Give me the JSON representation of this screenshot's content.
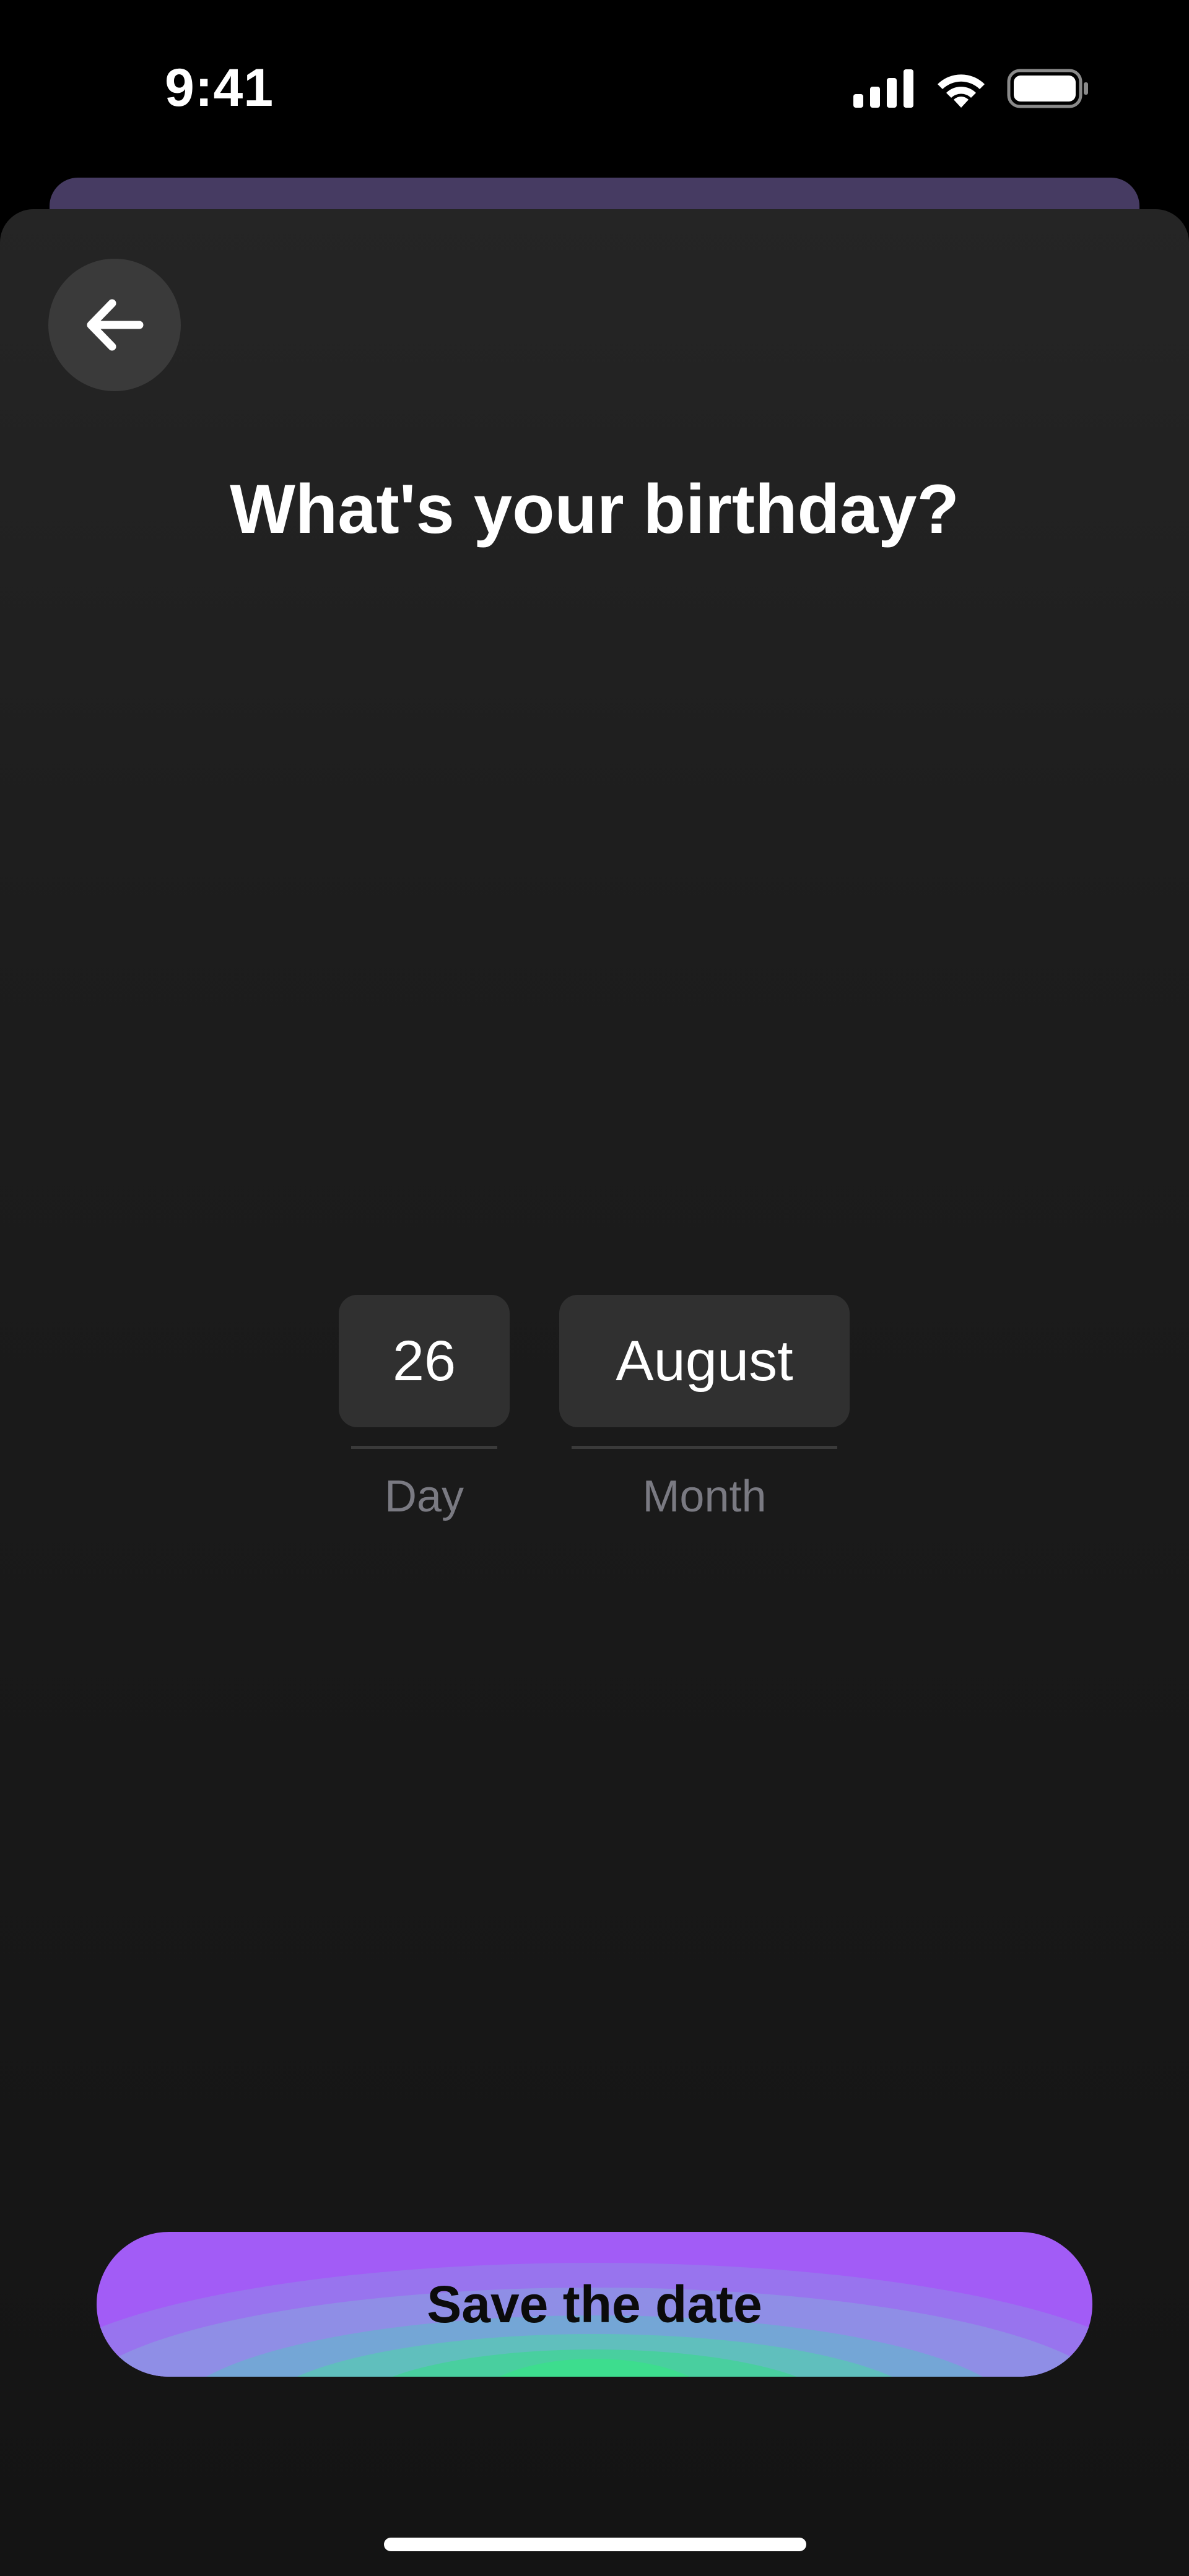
{
  "status_bar": {
    "time": "9:41",
    "icons": [
      "signal-icon",
      "wifi-icon",
      "battery-icon"
    ]
  },
  "header": {
    "back_icon": "arrow-left-icon",
    "title": "What's your birthday?"
  },
  "date_picker": {
    "day": {
      "value": "26",
      "label": "Day"
    },
    "month": {
      "value": "August",
      "label": "Month"
    }
  },
  "actions": {
    "save_label": "Save the date"
  },
  "colors": {
    "background": "#000000",
    "sheet": "#1d1d1d",
    "back_card": "#463b62",
    "picker_bg": "#303030",
    "label_gray": "#7a7a82",
    "button_purple": "#a25cf6",
    "button_green": "#3ddd8e"
  }
}
